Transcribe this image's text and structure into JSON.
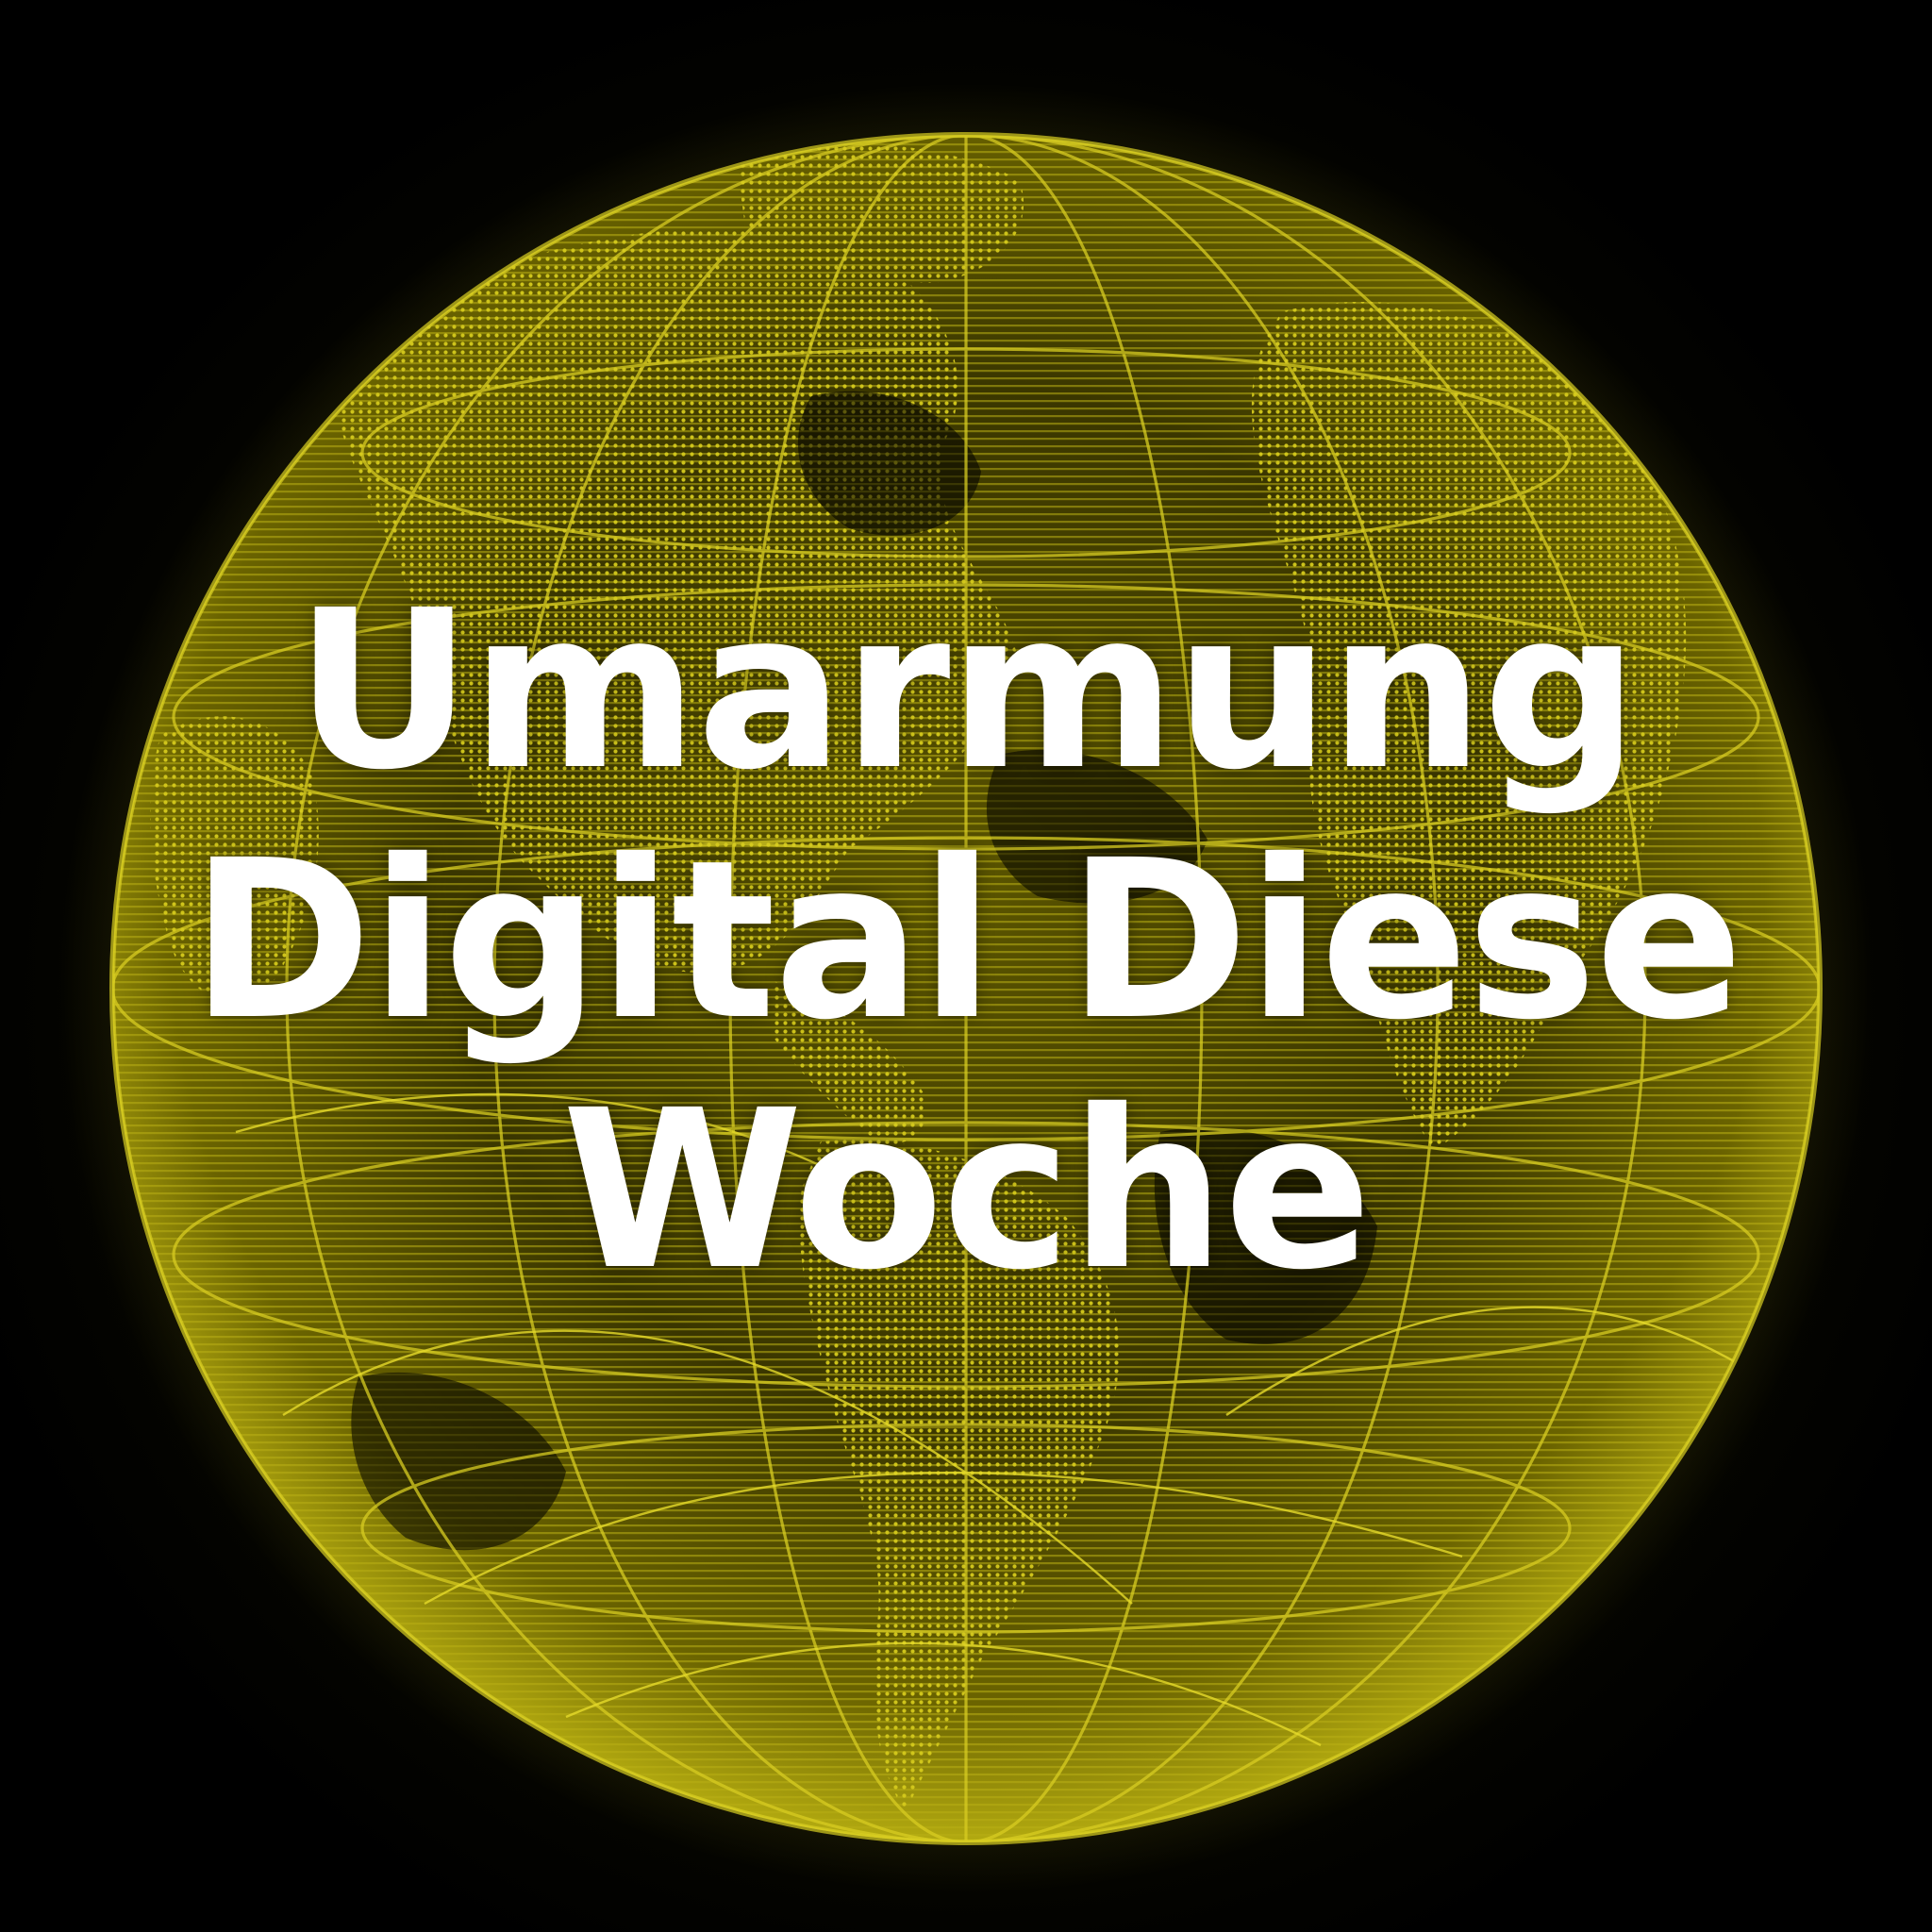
{
  "cover": {
    "title_lines": [
      "Umarmung",
      "Digital Diese",
      "Woche"
    ],
    "text_color": "#ffffff",
    "accent_color": "#c9bf1a",
    "background_color": "#000000"
  },
  "graphic": {
    "icon": "wireframe-globe-icon"
  }
}
